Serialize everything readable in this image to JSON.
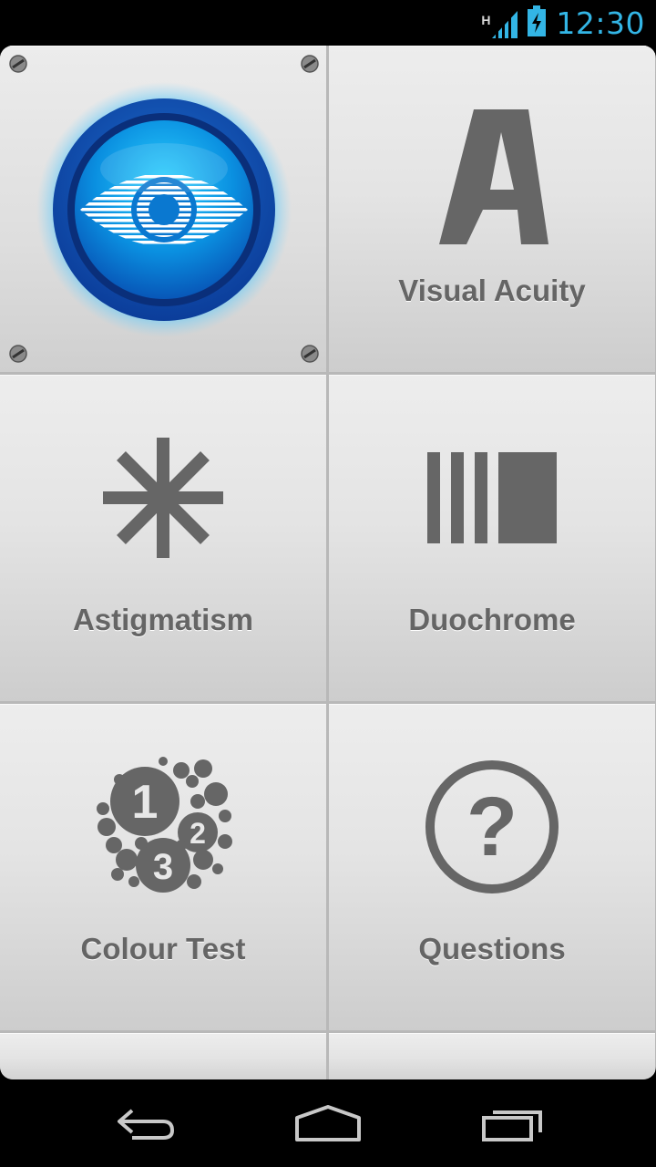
{
  "status_bar": {
    "network_type": "H",
    "time": "12:30",
    "icons": [
      "signal-icon",
      "battery-charging-icon"
    ],
    "accent_color": "#33b5e5"
  },
  "app": {
    "logo_icon": "eye-icon",
    "menu": [
      {
        "id": "visual-acuity",
        "label": "Visual Acuity",
        "icon": "letter-a-icon"
      },
      {
        "id": "astigmatism",
        "label": "Astigmatism",
        "icon": "asterisk-icon"
      },
      {
        "id": "duochrome",
        "label": "Duochrome",
        "icon": "bars-icon"
      },
      {
        "id": "colour-test",
        "label": "Colour Test",
        "icon": "color-plate-icon"
      },
      {
        "id": "questions",
        "label": "Questions",
        "icon": "question-icon"
      }
    ],
    "icon_color": "#666666"
  },
  "nav_bar": {
    "buttons": [
      "back-icon",
      "home-icon",
      "recent-apps-icon"
    ]
  }
}
